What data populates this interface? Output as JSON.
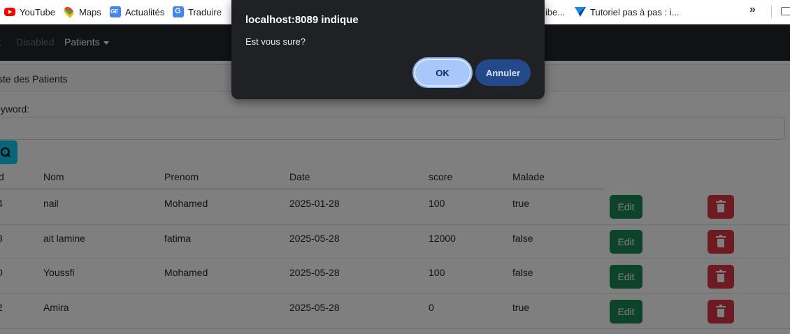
{
  "bookmarks": {
    "items": [
      {
        "label": "YouTube",
        "icon": "youtube-icon"
      },
      {
        "label": "Maps",
        "icon": "maps-icon"
      },
      {
        "label": "Actualités",
        "icon": "google-news-icon"
      },
      {
        "label": "Traduire",
        "icon": "google-translate-icon"
      },
      {
        "label": "ibe...",
        "icon": ""
      },
      {
        "label": "Tutoriel pas à pas : i...",
        "icon": "tutorial-icon"
      }
    ],
    "more_glyph": "»"
  },
  "navbar": {
    "brand": "k",
    "disabled_label": "Disabled",
    "patients_label": "Patients"
  },
  "card": {
    "header": "ste des Patients",
    "keyword_label": "eyword:",
    "keyword_value": ""
  },
  "table": {
    "headers": [
      "d",
      "Nom",
      "Prenom",
      "Date",
      "score",
      "Malade"
    ],
    "edit_label": "Edit",
    "rows": [
      {
        "id": "4",
        "nom": "nail",
        "prenom": "Mohamed",
        "date": "2025-01-28",
        "score": "100",
        "malade": "true"
      },
      {
        "id": "8",
        "nom": "ait lamine",
        "prenom": "fatima",
        "date": "2025-05-28",
        "score": "12000",
        "malade": "false"
      },
      {
        "id": "0",
        "nom": "Youssfi",
        "prenom": "Mohamed",
        "date": "2025-05-28",
        "score": "100",
        "malade": "false"
      },
      {
        "id": "2",
        "nom": "Amira",
        "prenom": "",
        "date": "2025-05-28",
        "score": "0",
        "malade": "true"
      }
    ]
  },
  "dialog": {
    "title": "localhost:8089 indique",
    "message": "Est vous sure?",
    "ok_label": "OK",
    "cancel_label": "Annuler"
  },
  "colors": {
    "navbar": "#212529",
    "edit_button": "#198754",
    "delete_button": "#dc3545",
    "search_button": "#0dcaf0",
    "dialog_bg": "#202124",
    "ok_button": "#a8c7fa",
    "cancel_button": "#24498a"
  }
}
